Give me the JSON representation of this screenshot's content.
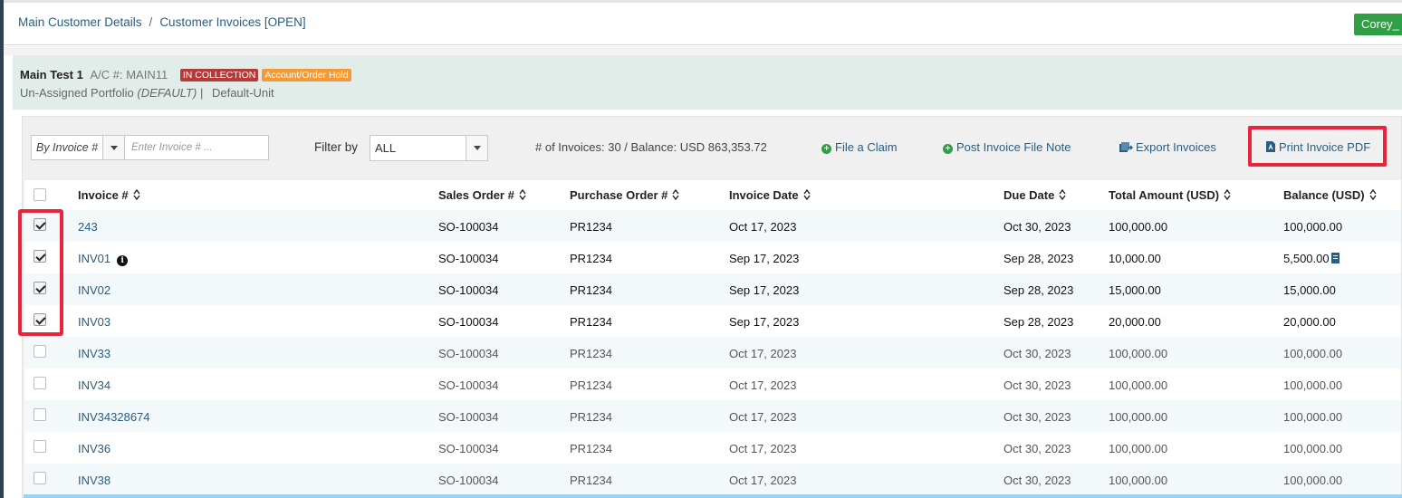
{
  "breadcrumb": {
    "items": [
      "Main Customer Details",
      "Customer Invoices [OPEN]"
    ],
    "separator": "/"
  },
  "user": {
    "label": "Corey_"
  },
  "account": {
    "name": "Main Test 1",
    "ac_label": "A/C #: MAIN11",
    "badges": [
      "IN COLLECTION",
      "Account/Order Hold"
    ],
    "portfolio": "Un-Assigned Portfolio",
    "portfolio_note": "(DEFAULT)",
    "divider": "|",
    "unit": "Default-Unit"
  },
  "toolbar": {
    "search_by": "By Invoice #",
    "invoice_placeholder": "Enter Invoice # ...",
    "filter_label": "Filter by",
    "filter_value": "ALL",
    "summary": "# of Invoices: 30  / Balance: USD 863,353.72",
    "file_claim": "File a Claim",
    "post_note": "Post Invoice File Note",
    "export": "Export Invoices",
    "print_pdf": "Print Invoice PDF"
  },
  "table": {
    "columns": [
      "Invoice #",
      "Sales Order #",
      "Purchase Order #",
      "Invoice Date",
      "Due Date",
      "Total Amount (USD)",
      "Balance (USD)"
    ],
    "rows": [
      {
        "invoice": "243",
        "so": "SO-100034",
        "po": "PR1234",
        "invoice_date": "Oct 17, 2023",
        "due_date": "Oct 30, 2023",
        "total": "100,000.00",
        "balance": "100,000.00",
        "checked": true
      },
      {
        "invoice": "INV01",
        "so": "SO-100034",
        "po": "PR1234",
        "invoice_date": "Sep 17, 2023",
        "due_date": "Sep 28, 2023",
        "total": "10,000.00",
        "balance": "5,500.00",
        "checked": true
      },
      {
        "invoice": "INV02",
        "so": "SO-100034",
        "po": "PR1234",
        "invoice_date": "Sep 17, 2023",
        "due_date": "Sep 28, 2023",
        "total": "15,000.00",
        "balance": "15,000.00",
        "checked": true
      },
      {
        "invoice": "INV03",
        "so": "SO-100034",
        "po": "PR1234",
        "invoice_date": "Sep 17, 2023",
        "due_date": "Sep 28, 2023",
        "total": "20,000.00",
        "balance": "20,000.00",
        "checked": true
      },
      {
        "invoice": "INV33",
        "so": "SO-100034",
        "po": "PR1234",
        "invoice_date": "Oct 17, 2023",
        "due_date": "Oct 30, 2023",
        "total": "100,000.00",
        "balance": "100,000.00",
        "checked": false
      },
      {
        "invoice": "INV34",
        "so": "SO-100034",
        "po": "PR1234",
        "invoice_date": "Oct 17, 2023",
        "due_date": "Oct 30, 2023",
        "total": "100,000.00",
        "balance": "100,000.00",
        "checked": false
      },
      {
        "invoice": "INV34328674",
        "so": "SO-100034",
        "po": "PR1234",
        "invoice_date": "Oct 17, 2023",
        "due_date": "Oct 30, 2023",
        "total": "100,000.00",
        "balance": "100,000.00",
        "checked": false
      },
      {
        "invoice": "INV36",
        "so": "SO-100034",
        "po": "PR1234",
        "invoice_date": "Oct 17, 2023",
        "due_date": "Oct 30, 2023",
        "total": "100,000.00",
        "balance": "100,000.00",
        "checked": false
      },
      {
        "invoice": "INV38",
        "so": "SO-100034",
        "po": "PR1234",
        "invoice_date": "Oct 17, 2023",
        "due_date": "Oct 30, 2023",
        "total": "100,000.00",
        "balance": "100,000.00",
        "checked": false
      }
    ]
  },
  "colors": {
    "link": "#2b5d7e",
    "highlight": "#e8253d",
    "green": "#2f9e44",
    "account_band": "#e2ede9"
  },
  "icons": [
    "plus-circle-icon",
    "export-icon",
    "pdf-icon",
    "sort-icon",
    "info-icon",
    "note-icon",
    "chevron-down-icon"
  ]
}
